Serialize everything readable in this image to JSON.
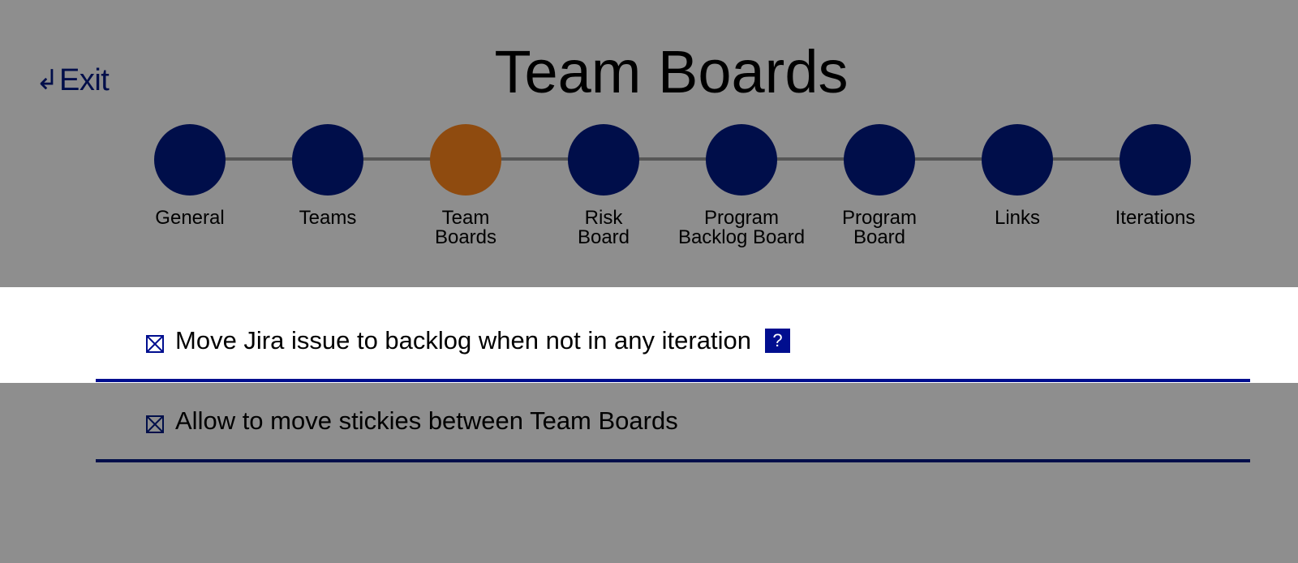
{
  "header": {
    "exit_arrow": "↲",
    "exit_label": "Exit",
    "title": "Team Boards"
  },
  "stepper": {
    "active_index": 2,
    "steps": [
      {
        "line1": "General",
        "line2": ""
      },
      {
        "line1": "Teams",
        "line2": ""
      },
      {
        "line1": "Team",
        "line2": "Boards"
      },
      {
        "line1": "Risk",
        "line2": "Board"
      },
      {
        "line1": "Program",
        "line2": "Backlog Board"
      },
      {
        "line1": "Program",
        "line2": "Board"
      },
      {
        "line1": "Links",
        "line2": ""
      },
      {
        "line1": "Iterations",
        "line2": ""
      }
    ]
  },
  "settings": [
    {
      "label": "Move Jira issue to backlog when not in any iteration",
      "checked": true,
      "help": "?"
    },
    {
      "label": "Allow to move stickies between Team Boards",
      "checked": true
    }
  ],
  "colors": {
    "overlay": "#8e8e8e",
    "step_default": "#000e4a",
    "step_active": "#8f4b0f",
    "accent": "#000e8f",
    "connector": "#575757"
  },
  "icons": {
    "exit": "return-arrow-icon",
    "checkbox": "checked-box-icon",
    "help": "question-mark-icon"
  }
}
